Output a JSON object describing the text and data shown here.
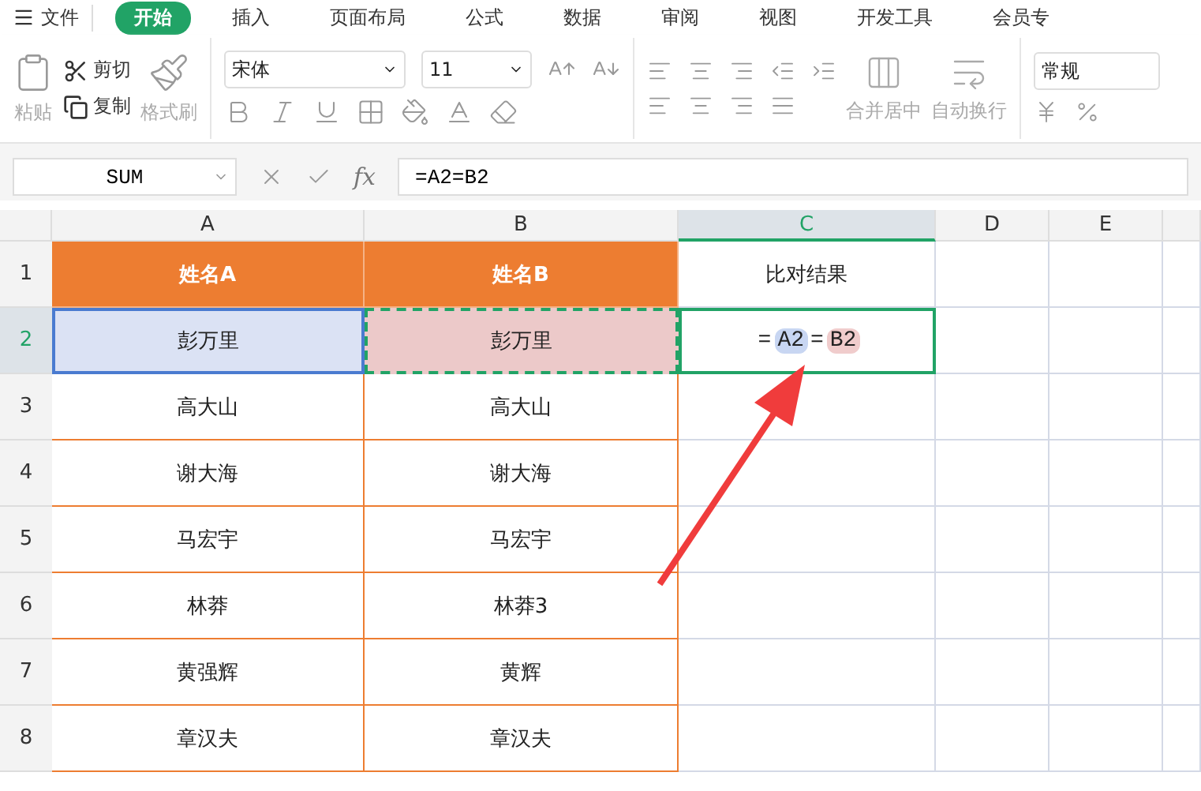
{
  "menu_bar": {
    "file_label": "文件",
    "tabs": [
      {
        "label": "开始",
        "selected": true
      },
      {
        "label": "插入",
        "selected": false
      },
      {
        "label": "页面布局",
        "selected": false
      },
      {
        "label": "公式",
        "selected": false
      },
      {
        "label": "数据",
        "selected": false
      },
      {
        "label": "审阅",
        "selected": false
      },
      {
        "label": "视图",
        "selected": false
      },
      {
        "label": "开发工具",
        "selected": false
      },
      {
        "label": "会员专",
        "selected": false
      }
    ]
  },
  "ribbon": {
    "paste": "粘贴",
    "cut": "剪切",
    "copy": "复制",
    "format_painter": "格式刷",
    "font_name": "宋体",
    "font_size": "11",
    "merge": "合并居中",
    "wrap": "自动换行",
    "number_format": "常规"
  },
  "formula_bar": {
    "name_box": "SUM",
    "fx_label": "fx",
    "formula": "=A2=B2"
  },
  "columns": [
    {
      "label": "A",
      "selected": false
    },
    {
      "label": "B",
      "selected": false
    },
    {
      "label": "C",
      "selected": true
    },
    {
      "label": "D",
      "selected": false
    },
    {
      "label": "E",
      "selected": false
    }
  ],
  "rows": [
    {
      "number": "1",
      "selected": false,
      "cells": [
        {
          "kind": "header",
          "text": "姓名A"
        },
        {
          "kind": "header",
          "text": "姓名B"
        },
        {
          "kind": "plain",
          "text": "比对结果"
        }
      ]
    },
    {
      "number": "2",
      "selected": true,
      "cells": [
        {
          "kind": "ref",
          "text": "彭万里",
          "color": "#dbe2f4",
          "dashed": false
        },
        {
          "kind": "ref",
          "text": "彭万里",
          "color": "#ecc9c9",
          "dashed": true
        },
        {
          "kind": "editing",
          "tokens": [
            {
              "text": "="
            },
            {
              "text": "A2",
              "color": "#c8d6f2"
            },
            {
              "text": "="
            },
            {
              "text": "B2",
              "color": "#f0cccc"
            }
          ]
        }
      ]
    },
    {
      "number": "3",
      "selected": false,
      "cells": [
        {
          "kind": "data",
          "text": "高大山"
        },
        {
          "kind": "data",
          "text": "高大山"
        },
        {
          "kind": "blank"
        }
      ]
    },
    {
      "number": "4",
      "selected": false,
      "cells": [
        {
          "kind": "data",
          "text": "谢大海"
        },
        {
          "kind": "data",
          "text": "谢大海"
        },
        {
          "kind": "blank"
        }
      ]
    },
    {
      "number": "5",
      "selected": false,
      "cells": [
        {
          "kind": "data",
          "text": "马宏宇"
        },
        {
          "kind": "data",
          "text": "马宏宇"
        },
        {
          "kind": "blank"
        }
      ]
    },
    {
      "number": "6",
      "selected": false,
      "cells": [
        {
          "kind": "data",
          "text": "林莽"
        },
        {
          "kind": "data",
          "text": "林莽3"
        },
        {
          "kind": "blank"
        }
      ]
    },
    {
      "number": "7",
      "selected": false,
      "cells": [
        {
          "kind": "data",
          "text": "黄强辉"
        },
        {
          "kind": "data",
          "text": "黄辉"
        },
        {
          "kind": "blank"
        }
      ]
    },
    {
      "number": "8",
      "selected": false,
      "cells": [
        {
          "kind": "data",
          "text": "章汉夫"
        },
        {
          "kind": "data",
          "text": "章汉夫"
        },
        {
          "kind": "blank"
        }
      ]
    }
  ]
}
